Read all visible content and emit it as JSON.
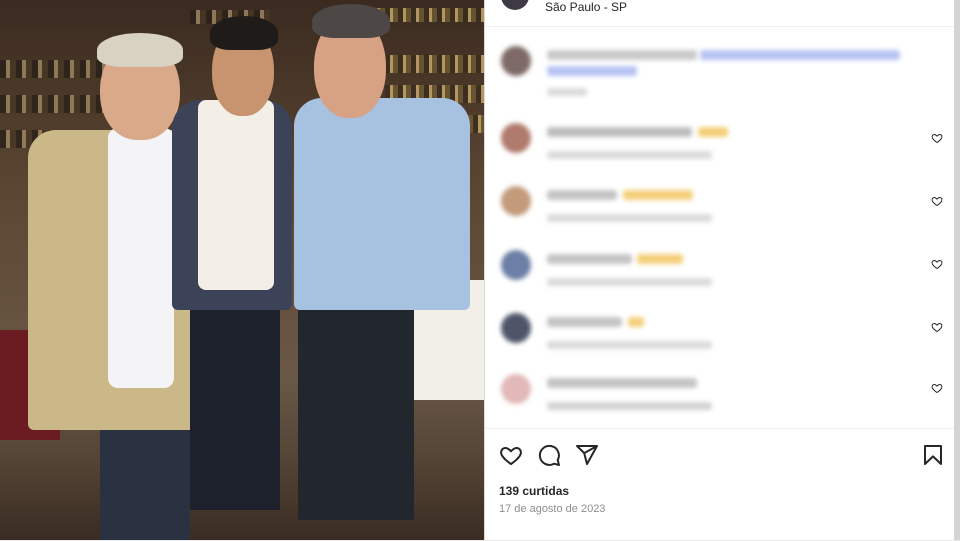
{
  "post": {
    "location": "São Paulo - SP",
    "likes_text": "139 curtidas",
    "date_text": "17 de agosto de 2023"
  },
  "icons": {
    "like": "heart-icon",
    "comment": "comment-bubble-icon",
    "share": "paper-plane-icon",
    "save": "bookmark-icon",
    "comment_like": "small-heart-icon"
  },
  "colors": {
    "text": "#262626",
    "muted": "#8e8e8e",
    "border": "#dbdbdb",
    "blurred_link": "#b7c3f2",
    "blurred_text": "#cfcfcf",
    "blurred_emoji": "#f4cf7a"
  },
  "comments_blurred": [
    {
      "avatar_color": "#7d6a66",
      "has_like": false
    },
    {
      "avatar_color": "#b07a6c",
      "has_like": true
    },
    {
      "avatar_color": "#c39a7a",
      "has_like": true
    },
    {
      "avatar_color": "#6d7fa6",
      "has_like": true
    },
    {
      "avatar_color": "#4e5568",
      "has_like": true
    },
    {
      "avatar_color": "#e2b8b8",
      "has_like": true
    }
  ]
}
